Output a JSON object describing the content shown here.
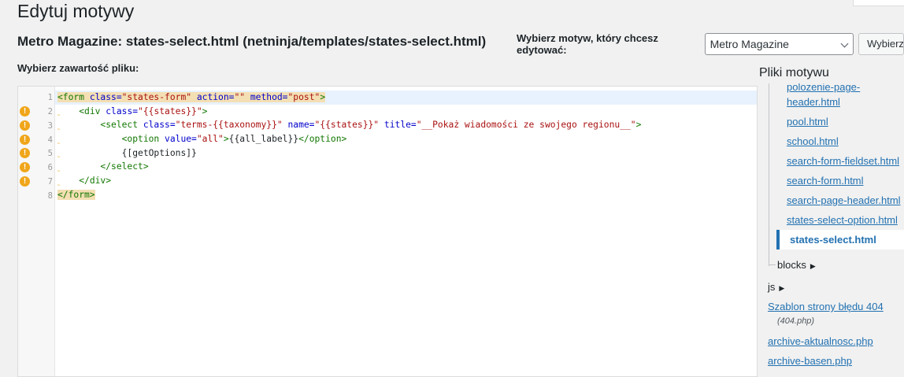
{
  "page": {
    "title": "Edytuj motywy",
    "file_heading": "Metro Magazine: states-select.html (netninja/templates/states-select.html)",
    "content_label": "Wybierz zawartość pliku:"
  },
  "theme_chooser": {
    "label": "Wybierz motyw, który chcesz edytować:",
    "selected": "Metro Magazine",
    "button_label": "Wybierz"
  },
  "editor": {
    "lines": [
      {
        "num": "1",
        "lint": false
      },
      {
        "num": "2",
        "lint": true
      },
      {
        "num": "3",
        "lint": true
      },
      {
        "num": "4",
        "lint": true
      },
      {
        "num": "5",
        "lint": true
      },
      {
        "num": "6",
        "lint": true
      },
      {
        "num": "7",
        "lint": true
      },
      {
        "num": "8",
        "lint": false
      }
    ],
    "lint_symbol": "!",
    "fold_symbol": "˷",
    "code": {
      "l1": {
        "t1": "<form",
        "a1": " class=",
        "s1": "\"states-form\"",
        "a2": " action=",
        "s2": "\"\"",
        "a3": " method=",
        "s3": "\"post\"",
        "t2": ">"
      },
      "l2": {
        "ind": "    ",
        "t1": "<div",
        "a1": " class=",
        "s1": "\"{{states}}\"",
        "t2": ">"
      },
      "l3": {
        "ind": "        ",
        "t1": "<select",
        "a1": " class=",
        "s1": "\"terms-{{taxonomy}}\"",
        "a2": " name=",
        "s2": "\"{{states}}\"",
        "a3": " title=",
        "s3": "\"__Pokaż wiadomości ze swojego regionu__\"",
        "t2": ">"
      },
      "l4": {
        "ind": "            ",
        "t1": "<option",
        "a1": " value=",
        "s1": "\"all\"",
        "t2": ">",
        "txt": "{{all_label}}",
        "t3": "</option>"
      },
      "l5": {
        "ind": "            ",
        "txt": "{[getOptions]}"
      },
      "l6": {
        "ind": "        ",
        "t1": "</select>"
      },
      "l7": {
        "ind": "    ",
        "t1": "</div>"
      },
      "l8": {
        "t1": "</form>"
      }
    }
  },
  "sidebar": {
    "title": "Pliki motywu",
    "files": [
      "polozenie-page-",
      "header.html",
      "pool.html",
      "school.html",
      "search-form-fieldset.html",
      "search-form.html",
      "search-page-header.html",
      "states-select-option.html",
      "states-select.html"
    ],
    "folders": [
      {
        "name": "blocks",
        "arrow": "▶"
      },
      {
        "name": "js",
        "arrow": "▶"
      }
    ],
    "templates": [
      {
        "name": "Szablon strony błędu 404",
        "file": "(404.php)"
      },
      {
        "name": "archive-aktualnosc.php"
      },
      {
        "name": "archive-basen.php"
      }
    ]
  }
}
